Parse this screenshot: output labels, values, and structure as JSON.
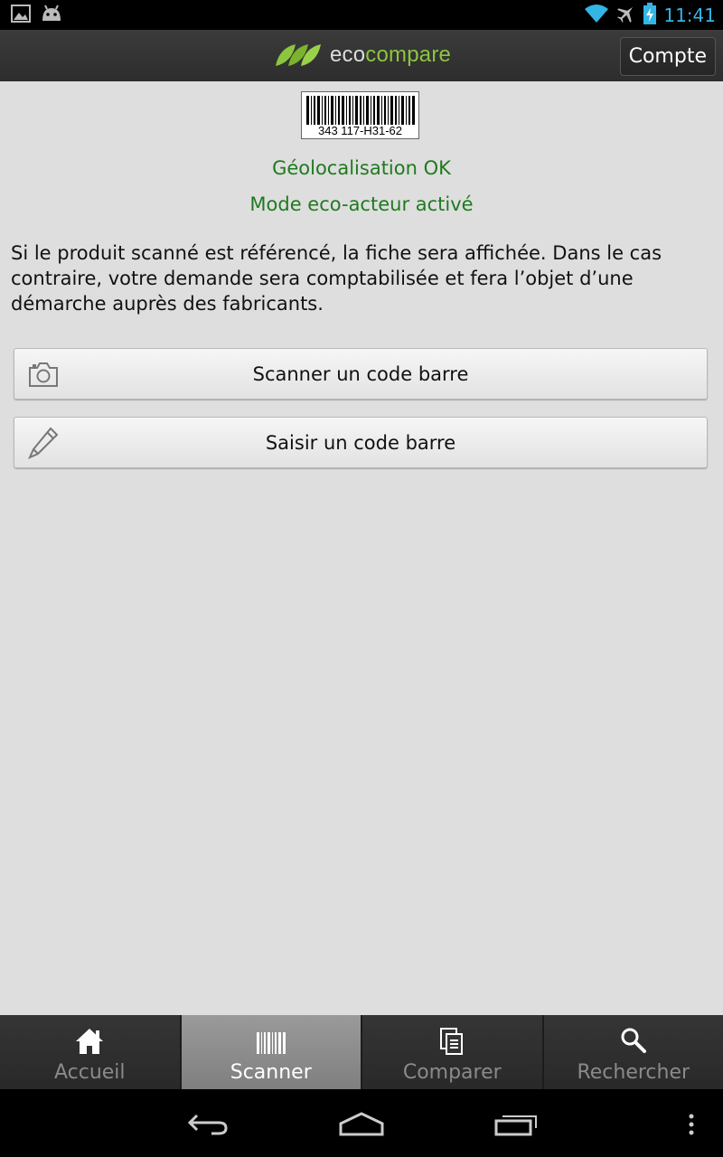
{
  "status_bar": {
    "time": "11:41",
    "left_icons": [
      "image-icon",
      "android-icon"
    ],
    "right_icons": [
      "wifi-icon",
      "airplane-icon",
      "battery-charging-icon"
    ],
    "time_color": "#33b5e5"
  },
  "action_bar": {
    "logo": {
      "part1": "eco",
      "part2": "compare"
    },
    "account_button": "Compte"
  },
  "barcode": {
    "number": "343 117-H31-62"
  },
  "status_messages": {
    "geolocation": "Géolocalisation OK",
    "eco_mode": "Mode eco-acteur activé",
    "color": "#1f7a1f"
  },
  "info_text": "Si le produit scanné est référencé, la fiche sera affichée. Dans le cas contraire, votre demande sera comptabilisée et fera l’objet d’une démarche auprès des fabricants.",
  "buttons": {
    "scan": {
      "label": "Scanner un code barre",
      "icon": "camera-icon"
    },
    "enter": {
      "label": "Saisir un code barre",
      "icon": "pencil-icon"
    }
  },
  "tabs": [
    {
      "label": "Accueil",
      "icon": "home-icon",
      "active": false
    },
    {
      "label": "Scanner",
      "icon": "barcode-icon",
      "active": true
    },
    {
      "label": "Comparer",
      "icon": "documents-icon",
      "active": false
    },
    {
      "label": "Rechercher",
      "icon": "search-icon",
      "active": false
    }
  ],
  "nav_bar": {
    "icons": [
      "back-icon",
      "home-icon",
      "recent-apps-icon",
      "menu-icon"
    ]
  }
}
